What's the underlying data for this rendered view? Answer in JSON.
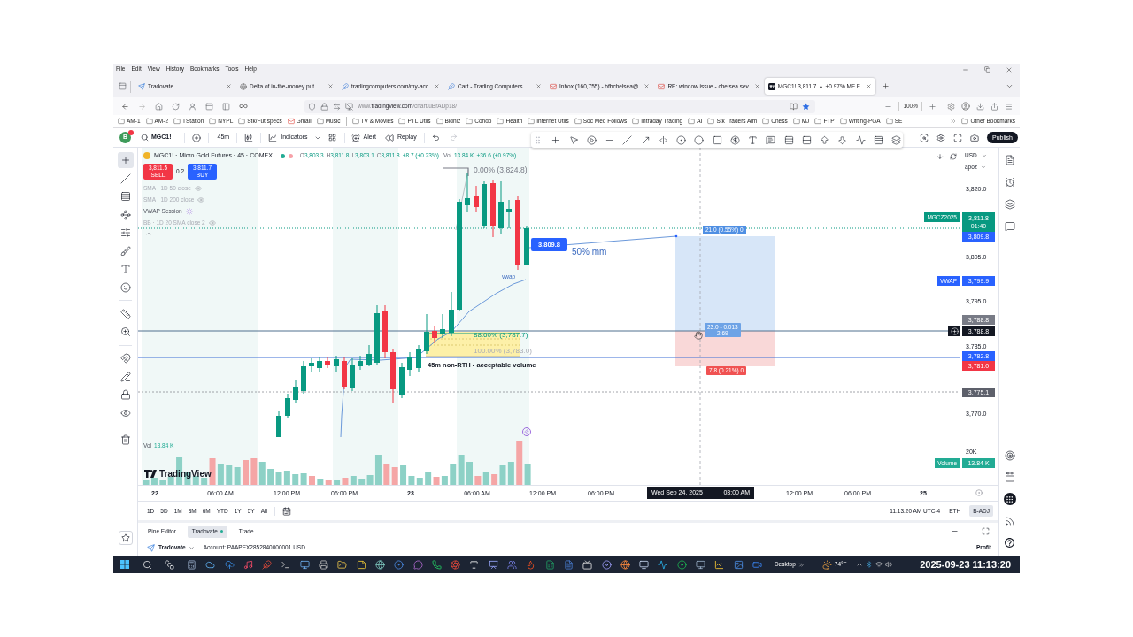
{
  "menu_bar": [
    "File",
    "Edit",
    "View",
    "History",
    "Bookmarks",
    "Tools",
    "Help"
  ],
  "tabs": [
    {
      "title": "Tradovate",
      "kind": "plane",
      "selected": false
    },
    {
      "title": "Delta of in-the-money put",
      "kind": "globe",
      "selected": false
    },
    {
      "title": "tradingcomputers.com/my-acc",
      "kind": "feather",
      "selected": false
    },
    {
      "title": "Cart - Trading Computers",
      "kind": "feather",
      "selected": false
    },
    {
      "title": "Inbox (160,755) - bfbchelsea@",
      "kind": "mail",
      "selected": false
    },
    {
      "title": "RE: window issue - chelsea.sev",
      "kind": "mail",
      "selected": false
    },
    {
      "title": "MGC1! 3,811.7 ▲ +0.97% MF F",
      "kind": "chart",
      "selected": true
    }
  ],
  "address_bar": {
    "url": "www.**tradingview.com**/chart/uBrADp18/"
  },
  "zoom_level": "100%",
  "bookmarks": [
    {
      "label": "AM-1",
      "kind": "folder"
    },
    {
      "label": "AM-2",
      "kind": "folder"
    },
    {
      "label": "TStation",
      "kind": "folder"
    },
    {
      "label": "NYPL",
      "kind": "folder"
    },
    {
      "label": "Stk/Fut specs",
      "kind": "folder"
    },
    {
      "label": "Gmail",
      "kind": "mail"
    },
    {
      "label": "Music",
      "kind": "folder"
    },
    {
      "label": "TV & Movies",
      "kind": "folder"
    },
    {
      "label": "PTL Utils",
      "kind": "folder"
    },
    {
      "label": "Bidniz",
      "kind": "folder"
    },
    {
      "label": "Condo",
      "kind": "folder"
    },
    {
      "label": "Health",
      "kind": "folder"
    },
    {
      "label": "Internet Utils",
      "kind": "folder"
    },
    {
      "label": "Soc Med Follows",
      "kind": "folder"
    },
    {
      "label": "Intraday Trading",
      "kind": "folder"
    },
    {
      "label": "AI",
      "kind": "folder"
    },
    {
      "label": "Stk Traders Alm",
      "kind": "folder"
    },
    {
      "label": "Chess",
      "kind": "folder"
    },
    {
      "label": "MJ",
      "kind": "folder"
    },
    {
      "label": "FTP",
      "kind": "folder"
    },
    {
      "label": "Writing-PGA",
      "kind": "folder"
    },
    {
      "label": "SE",
      "kind": "folder"
    }
  ],
  "other_bookmarks": "Other Bookmarks",
  "chart_toolbar": {
    "avatar": "B",
    "symbol": "MGC1!",
    "interval": "45m",
    "indicators": "Indicators",
    "alert": "Alert",
    "replay": "Replay",
    "publish": "Publish"
  },
  "drawing_tools": [
    {
      "selected": true
    },
    {
      "selected": false
    },
    {
      "selected": false
    },
    {
      "selected": false
    },
    {
      "selected": false
    },
    {
      "selected": false
    },
    {
      "selected": false
    },
    {
      "selected": false
    },
    {
      "selected": false
    },
    {
      "selected": false
    },
    {
      "selected": false
    },
    {
      "selected": false
    },
    {
      "selected": false
    },
    {
      "selected": false
    },
    {
      "selected": false
    }
  ],
  "legend": {
    "title": "MGC1! · Micro Gold Futures · 45 · COMEX",
    "ohlc": [
      {
        "label": "O",
        "value": "3,803.3"
      },
      {
        "label": "H",
        "value": "3,811.8"
      },
      {
        "label": "L",
        "value": "3,803.1"
      },
      {
        "label": "C",
        "value": "3,811.8"
      }
    ],
    "change": "+8.7 (+0.23%)",
    "volume_label": "Vol",
    "volume": "13.84 K",
    "volume_change": "+36.6 (+0.97%)"
  },
  "order_panel": {
    "sell_price": "3,811.5",
    "sell": "SELL",
    "spread": "0.2",
    "buy_price": "3,811.7",
    "buy": "BUY"
  },
  "studies": [
    {
      "name": "SMA · 1D 50 close",
      "hidden": true
    },
    {
      "name": "SMA · 1D 200 close",
      "hidden": true
    },
    {
      "name": "VWAP Session",
      "hidden": false
    },
    {
      "name": "BB · 1D 20 SMA close 2",
      "hidden": true
    }
  ],
  "annotations": {
    "fib_top": "0.00% (3,824.8)",
    "price_tag": "3,809.8",
    "measured_move": "50% mm",
    "vwap": "vwap",
    "fib_886": "88.60% (3,787.7)",
    "fib_100": "100.00% (3,783.0)",
    "note": "45m non-RTH - acceptable volume"
  },
  "position": {
    "target": "21.0 (0.55%) 0",
    "ratio": "23.0 - 0.013",
    "ratio_value": "2.69",
    "stop": "7.8 (0.21%) 0"
  },
  "price_scale": {
    "currency": "USD",
    "unit": "apoz",
    "labels": [
      {
        "text": "3,820.0",
        "kind": "tick"
      },
      {
        "text": "3,811.8",
        "sub": "01:40",
        "tag": "MGCZ2025",
        "kind": "badge",
        "color": "#089981"
      },
      {
        "text": "3,809.8",
        "kind": "badge",
        "color": "#2962ff"
      },
      {
        "text": "3,805.0",
        "kind": "tick"
      },
      {
        "text": "3,799.9",
        "tag": "VWAP",
        "kind": "badge",
        "color": "#2962ff"
      },
      {
        "text": "3,795.0",
        "kind": "tick"
      },
      {
        "text": "3,788.8",
        "kind": "badge",
        "color": "#787b86"
      },
      {
        "text": "3,788.8",
        "kind": "crosshair",
        "color": "#131722"
      },
      {
        "text": "3,785.0",
        "kind": "tick"
      },
      {
        "text": "3,782.8",
        "kind": "badge",
        "color": "#2962ff"
      },
      {
        "text": "3,781.0",
        "kind": "badge",
        "color": "#f23645"
      },
      {
        "text": "3,775.1",
        "kind": "badge",
        "color": "#5d606b"
      },
      {
        "text": "3,770.0",
        "kind": "tick"
      },
      {
        "text": "20K",
        "kind": "tick"
      },
      {
        "text": "13.84 K",
        "tag": "Volume",
        "kind": "badge",
        "color": "#22ab94"
      }
    ]
  },
  "volume_pane": {
    "label": "Vol",
    "value": "13.84 K"
  },
  "logo": "TradingView",
  "time_axis": {
    "labels": [
      {
        "text": "22",
        "kind": "day"
      },
      {
        "text": "06:00 AM",
        "kind": "time"
      },
      {
        "text": "12:00 PM",
        "kind": "time"
      },
      {
        "text": "06:00 PM",
        "kind": "time"
      },
      {
        "text": "23",
        "kind": "day"
      },
      {
        "text": "06:00 AM",
        "kind": "time"
      },
      {
        "text": "12:00 PM",
        "kind": "time"
      },
      {
        "text": "06:00 PM",
        "kind": "time"
      },
      {
        "text": "12:00 PM",
        "kind": "time"
      },
      {
        "text": "06:00 PM",
        "kind": "time"
      },
      {
        "text": "25",
        "kind": "day"
      }
    ],
    "crosshair_date": "Wed Sep 24, 2025",
    "crosshair_time": "03:00 AM"
  },
  "range_bar": {
    "ranges": [
      "1D",
      "5D",
      "1M",
      "3M",
      "6M",
      "YTD",
      "1Y",
      "5Y",
      "All"
    ],
    "clock": "11:13:20 AM UTC-4",
    "toggles": [
      {
        "label": "ETH",
        "on": false
      },
      {
        "label": "B-ADJ",
        "on": true
      }
    ]
  },
  "bottom_panel": {
    "tabs": [
      {
        "label": "Pine Editor",
        "selected": false,
        "connected": false
      },
      {
        "label": "Tradovate",
        "selected": true,
        "connected": true
      },
      {
        "label": "Trade",
        "selected": false,
        "connected": false
      }
    ],
    "broker": "Tradovate",
    "account": "Account: PAAPEX2852840000001 USD",
    "profit": "Profit"
  },
  "taskbar": {
    "desktop": "Desktop",
    "weather": "74°F",
    "datetime": "2025-09-23 11:13:20"
  }
}
